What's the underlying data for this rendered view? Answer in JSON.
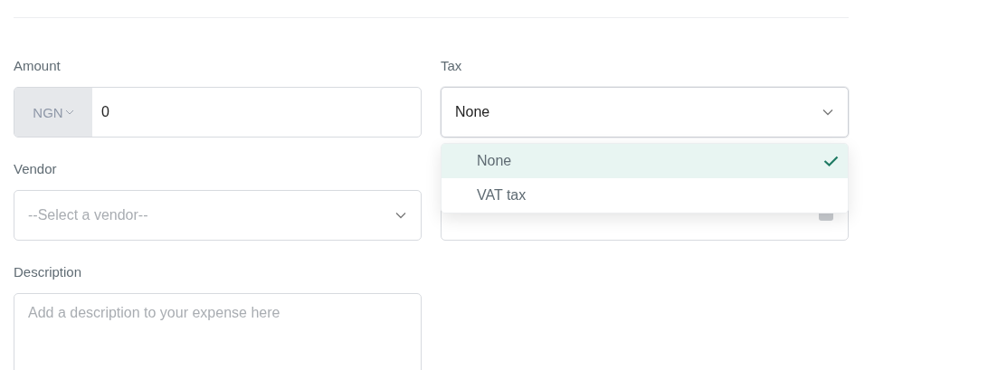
{
  "amount": {
    "label": "Amount",
    "currency": "NGN",
    "value": "0"
  },
  "vendor": {
    "label": "Vendor",
    "placeholder": "--Select a vendor--"
  },
  "description": {
    "label": "Description",
    "placeholder": "Add a description to your expense here"
  },
  "tax": {
    "label": "Tax",
    "value": "None",
    "expanded": true,
    "options": [
      {
        "label": "None",
        "selected": true
      },
      {
        "label": "VAT tax",
        "selected": false
      }
    ]
  }
}
